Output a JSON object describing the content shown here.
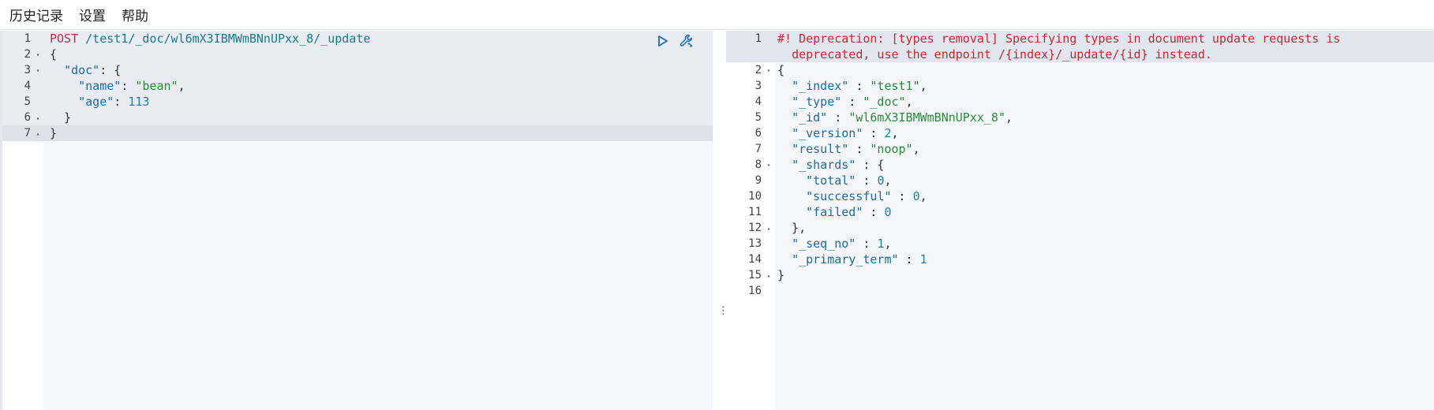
{
  "menu": {
    "history": "历史记录",
    "settings": "设置",
    "help": "帮助"
  },
  "request": {
    "lines": [
      {
        "n": "1",
        "fold": "",
        "parts": [
          [
            "method",
            "POST"
          ],
          [
            "punct",
            " "
          ],
          [
            "url",
            "/test1/_doc/wl6mX3IBMWmBNnUPxx_8/_update"
          ]
        ]
      },
      {
        "n": "2",
        "fold": "▾",
        "parts": [
          [
            "punct",
            "{"
          ]
        ]
      },
      {
        "n": "3",
        "fold": "▾",
        "parts": [
          [
            "punct",
            "  "
          ],
          [
            "key",
            "\"doc\""
          ],
          [
            "punct",
            ": {"
          ]
        ]
      },
      {
        "n": "4",
        "fold": "",
        "parts": [
          [
            "punct",
            "    "
          ],
          [
            "key",
            "\"name\""
          ],
          [
            "punct",
            ": "
          ],
          [
            "str",
            "\"bean\""
          ],
          [
            "punct",
            ","
          ]
        ]
      },
      {
        "n": "5",
        "fold": "",
        "parts": [
          [
            "punct",
            "    "
          ],
          [
            "key",
            "\"age\""
          ],
          [
            "punct",
            ": "
          ],
          [
            "num",
            "113"
          ]
        ]
      },
      {
        "n": "6",
        "fold": "▴",
        "parts": [
          [
            "punct",
            "  }"
          ]
        ]
      },
      {
        "n": "7",
        "fold": "▴",
        "parts": [
          [
            "punct",
            "}"
          ]
        ]
      }
    ]
  },
  "response": {
    "lines": [
      {
        "n": "1",
        "fold": "",
        "tall": true,
        "parts": [
          [
            "warn",
            "#! Deprecation: [types removal] Specifying types in document update requests is\n  deprecated, use the endpoint /{index}/_update/{id} instead."
          ]
        ]
      },
      {
        "n": "2",
        "fold": "▾",
        "parts": [
          [
            "punct",
            "{"
          ]
        ]
      },
      {
        "n": "3",
        "fold": "",
        "parts": [
          [
            "punct",
            "  "
          ],
          [
            "key",
            "\"_index\""
          ],
          [
            "punct",
            " : "
          ],
          [
            "str",
            "\"test1\""
          ],
          [
            "punct",
            ","
          ]
        ]
      },
      {
        "n": "4",
        "fold": "",
        "parts": [
          [
            "punct",
            "  "
          ],
          [
            "key",
            "\"_type\""
          ],
          [
            "punct",
            " : "
          ],
          [
            "str",
            "\"_doc\""
          ],
          [
            "punct",
            ","
          ]
        ]
      },
      {
        "n": "5",
        "fold": "",
        "parts": [
          [
            "punct",
            "  "
          ],
          [
            "key",
            "\"_id\""
          ],
          [
            "punct",
            " : "
          ],
          [
            "str",
            "\"wl6mX3IBMWmBNnUPxx_8\""
          ],
          [
            "punct",
            ","
          ]
        ]
      },
      {
        "n": "6",
        "fold": "",
        "parts": [
          [
            "punct",
            "  "
          ],
          [
            "key",
            "\"_version\""
          ],
          [
            "punct",
            " : "
          ],
          [
            "num",
            "2"
          ],
          [
            "punct",
            ","
          ]
        ]
      },
      {
        "n": "7",
        "fold": "",
        "parts": [
          [
            "punct",
            "  "
          ],
          [
            "key",
            "\"result\""
          ],
          [
            "punct",
            " : "
          ],
          [
            "str",
            "\"noop\""
          ],
          [
            "punct",
            ","
          ]
        ]
      },
      {
        "n": "8",
        "fold": "▾",
        "parts": [
          [
            "punct",
            "  "
          ],
          [
            "key",
            "\"_shards\""
          ],
          [
            "punct",
            " : {"
          ]
        ]
      },
      {
        "n": "9",
        "fold": "",
        "parts": [
          [
            "punct",
            "    "
          ],
          [
            "key",
            "\"total\""
          ],
          [
            "punct",
            " : "
          ],
          [
            "num",
            "0"
          ],
          [
            "punct",
            ","
          ]
        ]
      },
      {
        "n": "10",
        "fold": "",
        "parts": [
          [
            "punct",
            "    "
          ],
          [
            "key",
            "\"successful\""
          ],
          [
            "punct",
            " : "
          ],
          [
            "num",
            "0"
          ],
          [
            "punct",
            ","
          ]
        ]
      },
      {
        "n": "11",
        "fold": "",
        "parts": [
          [
            "punct",
            "    "
          ],
          [
            "key",
            "\"failed\""
          ],
          [
            "punct",
            " : "
          ],
          [
            "num",
            "0"
          ]
        ]
      },
      {
        "n": "12",
        "fold": "▴",
        "parts": [
          [
            "punct",
            "  },"
          ]
        ]
      },
      {
        "n": "13",
        "fold": "",
        "parts": [
          [
            "punct",
            "  "
          ],
          [
            "key",
            "\"_seq_no\""
          ],
          [
            "punct",
            " : "
          ],
          [
            "num",
            "1"
          ],
          [
            "punct",
            ","
          ]
        ]
      },
      {
        "n": "14",
        "fold": "",
        "parts": [
          [
            "punct",
            "  "
          ],
          [
            "key",
            "\"_primary_term\""
          ],
          [
            "punct",
            " : "
          ],
          [
            "num",
            "1"
          ]
        ]
      },
      {
        "n": "15",
        "fold": "▴",
        "parts": [
          [
            "punct",
            "}"
          ]
        ]
      },
      {
        "n": "16",
        "fold": "",
        "parts": []
      }
    ]
  },
  "icons": {
    "run": "play-icon",
    "copy_as_curl": "wrench-icon"
  },
  "colors": {
    "method": "#c22b4a",
    "key": "#1c6aa8",
    "string": "#2a8a3b",
    "number": "#1c7fa6",
    "warning": "#c8272f"
  }
}
